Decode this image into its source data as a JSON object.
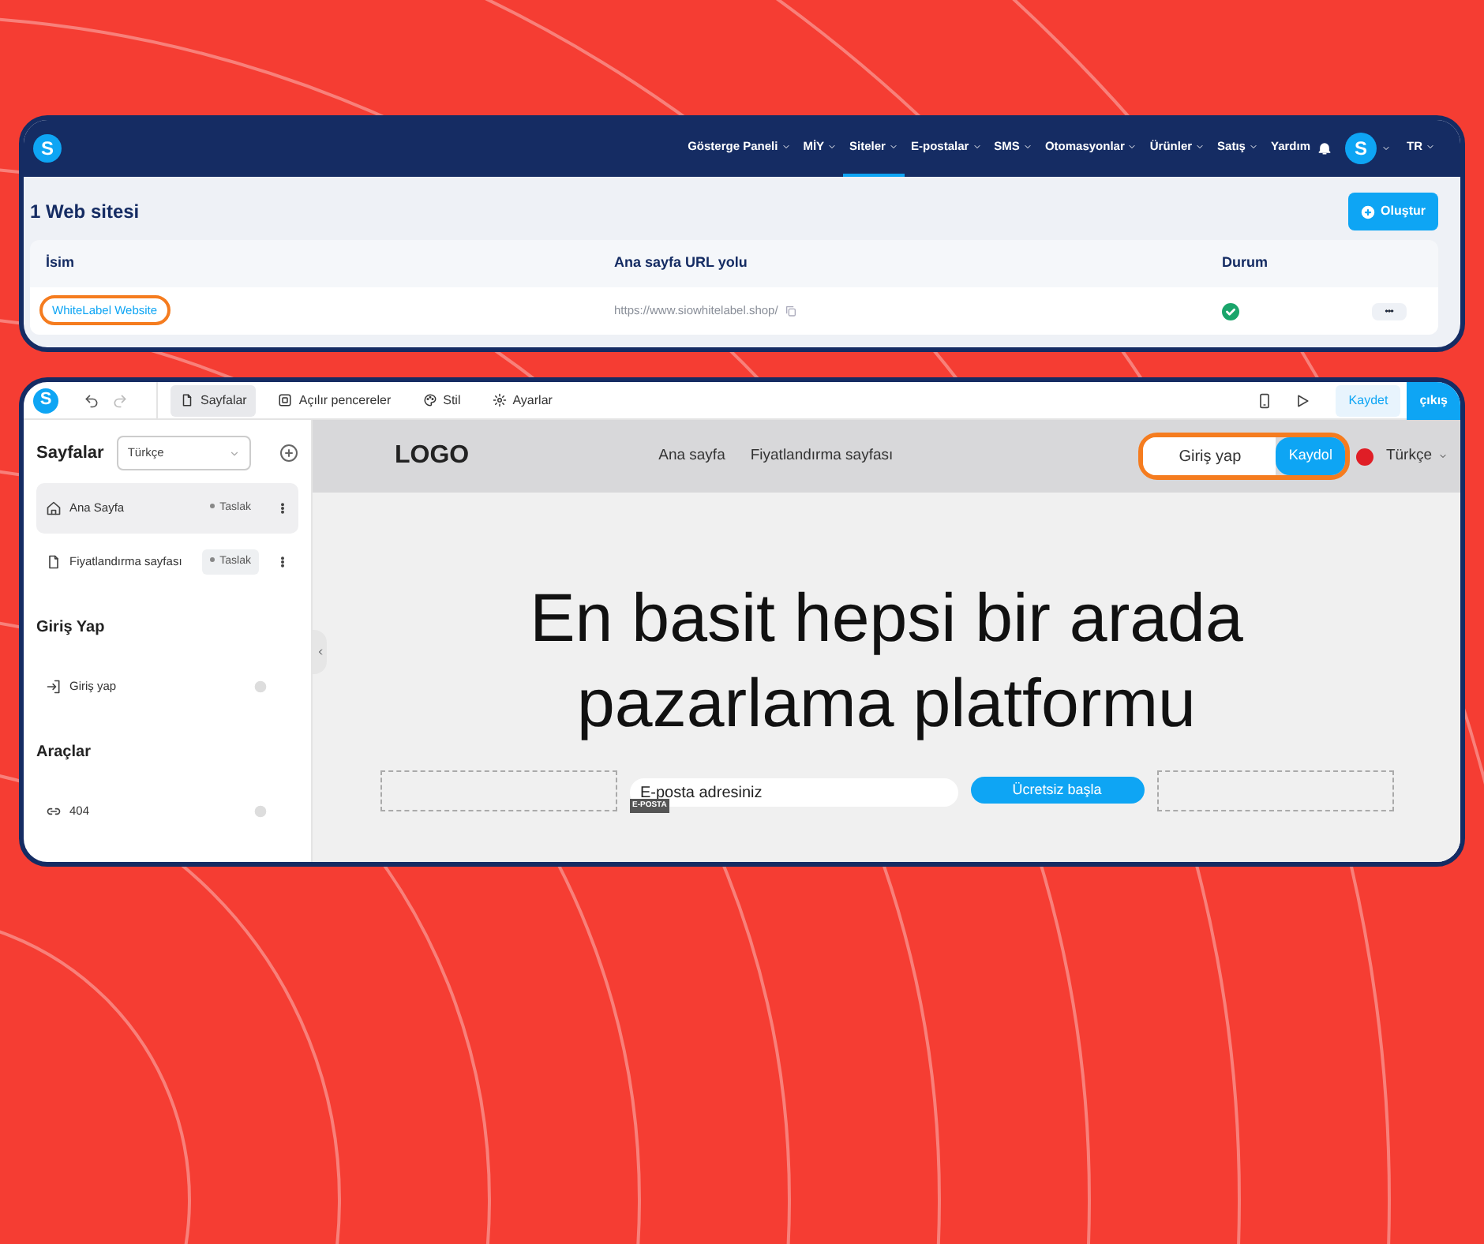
{
  "dashboard": {
    "logo_letter": "S",
    "nav": [
      {
        "label": "Gösterge Paneli",
        "caret": true,
        "selected": false
      },
      {
        "label": "MİY",
        "caret": true,
        "selected": false
      },
      {
        "label": "Siteler",
        "caret": true,
        "selected": true
      },
      {
        "label": "E-postalar",
        "caret": true,
        "selected": false
      },
      {
        "label": "SMS",
        "caret": true,
        "selected": false
      },
      {
        "label": "Otomasyonlar",
        "caret": true,
        "selected": false
      },
      {
        "label": "Ürünler",
        "caret": true,
        "selected": false
      },
      {
        "label": "Satış",
        "caret": true,
        "selected": false
      },
      {
        "label": "Yardım",
        "caret": false,
        "selected": false
      }
    ],
    "avatar_letter": "S",
    "language": "TR",
    "title": "1 Web sitesi",
    "create_button": "Oluştur",
    "table": {
      "columns": [
        "İsim",
        "Ana sayfa URL yolu",
        "Durum"
      ],
      "rows": [
        {
          "name": "WhiteLabel Website",
          "highlighted": true,
          "url": "https://www.siowhitelabel.shop/",
          "published": true
        }
      ]
    }
  },
  "editor": {
    "logo_letter": "S",
    "tabs": [
      {
        "label": "Sayfalar",
        "kind": "page",
        "selected": true
      },
      {
        "label": "Açılır pencereler",
        "kind": "popup",
        "selected": false
      },
      {
        "label": "Stil",
        "kind": "palette",
        "selected": false
      },
      {
        "label": "Ayarlar",
        "kind": "gear",
        "selected": false
      }
    ],
    "save_button": "Kaydet",
    "exit_button": "çıkış",
    "sidebar": {
      "title": "Sayfalar",
      "language_select": "Türkçe",
      "sections": [
        {
          "items": [
            {
              "label": "Ana Sayfa",
              "kind": "home",
              "badge": "Taslak",
              "selected": true
            },
            {
              "label": "Fiyatlandırma sayfası",
              "kind": "page",
              "badge": "Taslak",
              "selected": false
            }
          ]
        },
        {
          "title": "Giriş Yap",
          "items": [
            {
              "label": "Giriş yap",
              "kind": "login",
              "selected": false
            }
          ]
        },
        {
          "title": "Araçlar",
          "items": [
            {
              "label": "404",
              "kind": "link",
              "selected": false
            }
          ]
        }
      ]
    },
    "preview": {
      "logo": "LOGO",
      "links": [
        "Ana sayfa",
        "Fiyatlandırma sayfası"
      ],
      "login_button": "Giriş yap",
      "signup_button": "Kaydol",
      "auth_highlighted": true,
      "language": "Türkçe",
      "headline": [
        "En basit hepsi bir arada",
        "pazarlama platformu"
      ],
      "email_placeholder": "E-posta adresiniz",
      "email_tag": "E-POSTA",
      "cta_button": "Ücretsiz başla"
    }
  }
}
